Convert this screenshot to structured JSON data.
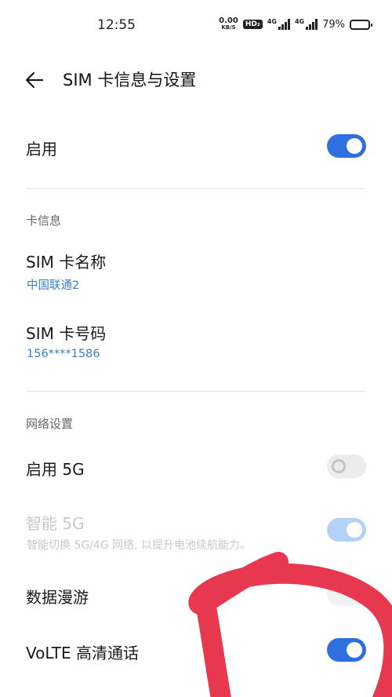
{
  "status_bar": {
    "time": "12:55",
    "net_speed_value": "0.00",
    "net_speed_unit": "KB/S",
    "hd_badge": "HD₂",
    "signal1_label": "4G",
    "signal2_label": "4G",
    "battery_percent": "79%",
    "battery_level": 0.79
  },
  "app_bar": {
    "title": "SIM 卡信息与设置",
    "back_icon": "arrow-left-icon"
  },
  "enable_row": {
    "label": "启用",
    "enabled": true
  },
  "card_info": {
    "section_label": "卡信息",
    "sim_name_label": "SIM 卡名称",
    "sim_name_value": "中国联通2",
    "sim_number_label": "SIM 卡号码",
    "sim_number_value": "156****1586"
  },
  "network": {
    "section_label": "网络设置",
    "enable_5g_label": "启用 5G",
    "enable_5g": false,
    "smart_5g_label": "智能 5G",
    "smart_5g_desc": "智能切换 5G/4G 网络, 以提升电池续航能力。",
    "smart_5g": true,
    "data_roaming_label": "数据漫游",
    "volte_label": "VoLTE 高清通话",
    "volte": true
  },
  "colors": {
    "accent": "#2f6fe0",
    "link_text": "#3b7ec2",
    "annotation_red": "#e8384f"
  }
}
